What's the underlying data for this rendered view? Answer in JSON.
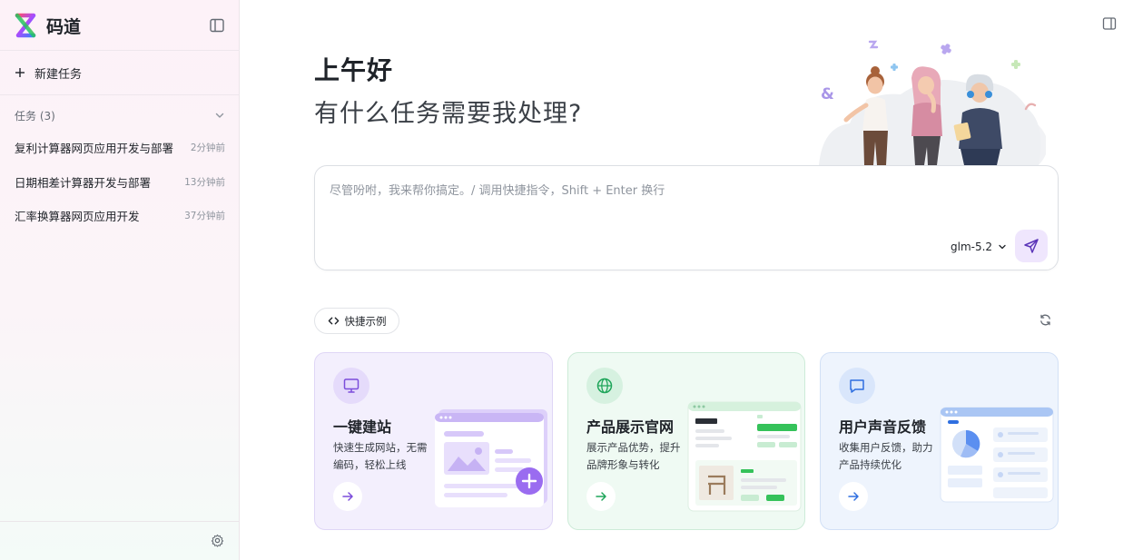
{
  "app": {
    "name": "码道"
  },
  "sidebar": {
    "new_task_label": "新建任务",
    "tasks_header": "任务 (3)",
    "tasks": [
      {
        "title": "复利计算器网页应用开发与部署",
        "time": "2分钟前"
      },
      {
        "title": "日期相差计算器开发与部署",
        "time": "13分钟前"
      },
      {
        "title": "汇率换算器网页应用开发",
        "time": "37分钟前"
      }
    ]
  },
  "main": {
    "greeting": "上午好",
    "subtitle": "有什么任务需要我处理?",
    "input": {
      "placeholder": "尽管吩咐，我来帮你搞定。/ 调用快捷指令，Shift + Enter 换行",
      "value": ""
    },
    "model": "glm-5.2",
    "quick_examples_label": "快捷示例",
    "cards": [
      {
        "title": "一键建站",
        "desc": "快速生成网站，无需编码，轻松上线",
        "icon": "monitor-icon",
        "color": "#7c4ddb"
      },
      {
        "title": "产品展示官网",
        "desc": "展示产品优势，提升品牌形象与转化",
        "icon": "globe-icon",
        "color": "#1fa55a"
      },
      {
        "title": "用户声音反馈",
        "desc": "收集用户反馈，助力产品持续优化",
        "icon": "chat-icon",
        "color": "#2f6fe0"
      }
    ]
  },
  "colors": {
    "accent_purple": "#7c4ddb",
    "send_bg": "#efe6fd"
  }
}
